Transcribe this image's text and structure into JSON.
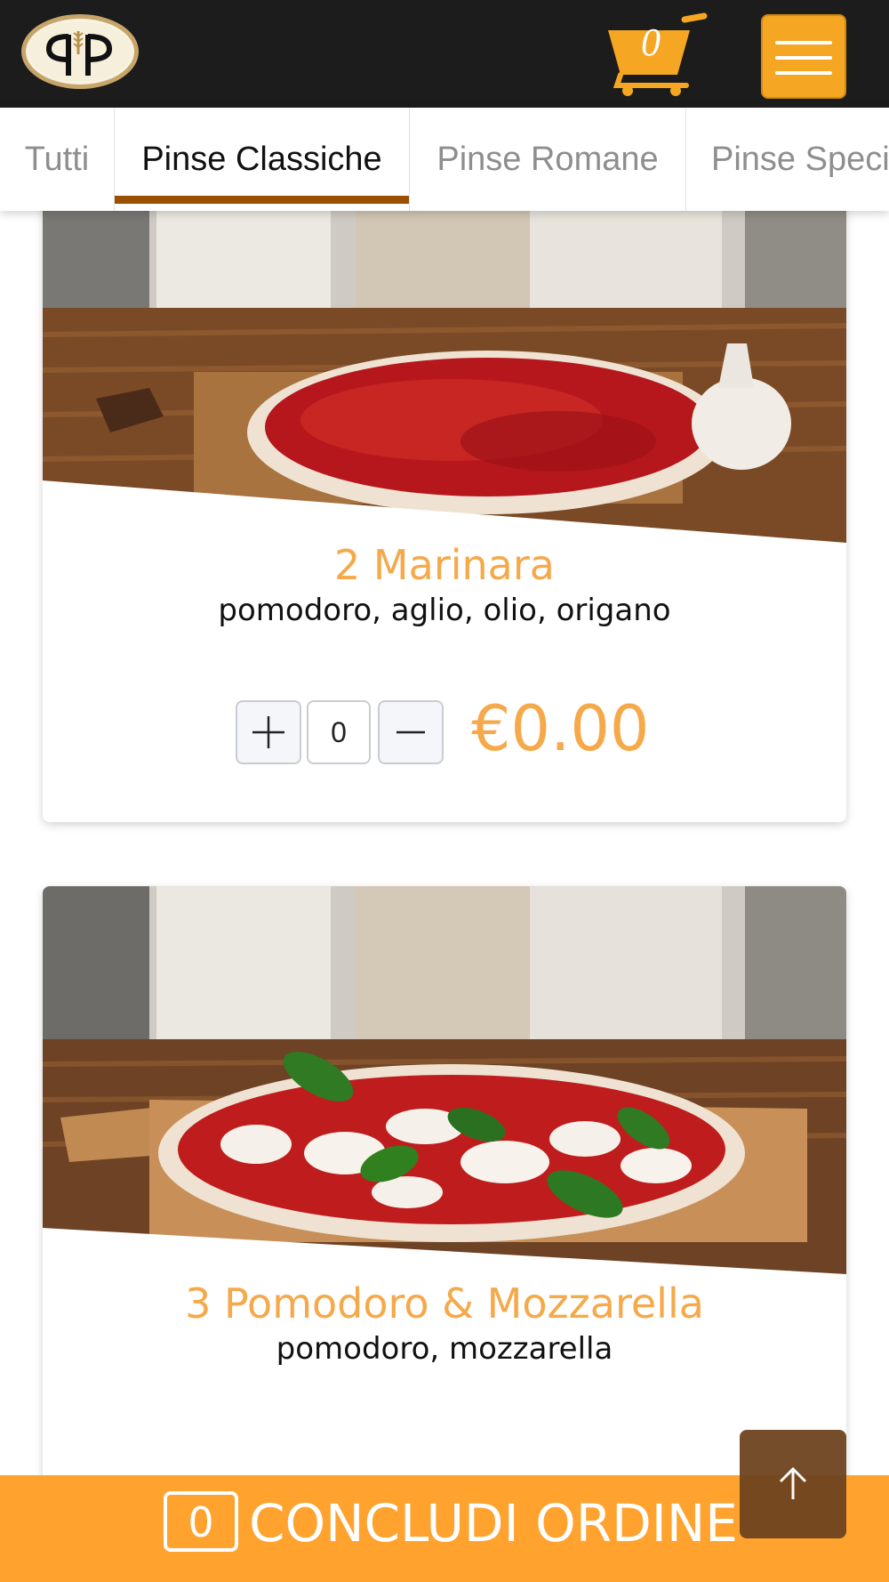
{
  "header": {
    "logo_icon": "pinsa-logo-icon",
    "cart_icon": "shopping-cart-icon",
    "cart_count": "0",
    "menu_icon": "hamburger-menu-icon",
    "accent_color": "#f5a623"
  },
  "tabs": [
    {
      "label": "Tutti",
      "active": false
    },
    {
      "label": "Pinse Classiche",
      "active": true
    },
    {
      "label": "Pinse Romane",
      "active": false
    },
    {
      "label": "Pinse Speci",
      "active": false
    }
  ],
  "products": [
    {
      "title": "2 Marinara",
      "description": "pomodoro, aglio, olio, origano",
      "quantity": "0",
      "price": "€0.00",
      "plus_icon": "plus-icon",
      "minus_icon": "minus-icon"
    },
    {
      "title": "3 Pomodoro & Mozzarella",
      "description": "pomodoro, mozzarella"
    }
  ],
  "footer": {
    "order_count": "0",
    "label": "CONCLUDI ORDINE",
    "color": "#ffa22e"
  },
  "scroll_top_icon": "arrow-up-icon"
}
